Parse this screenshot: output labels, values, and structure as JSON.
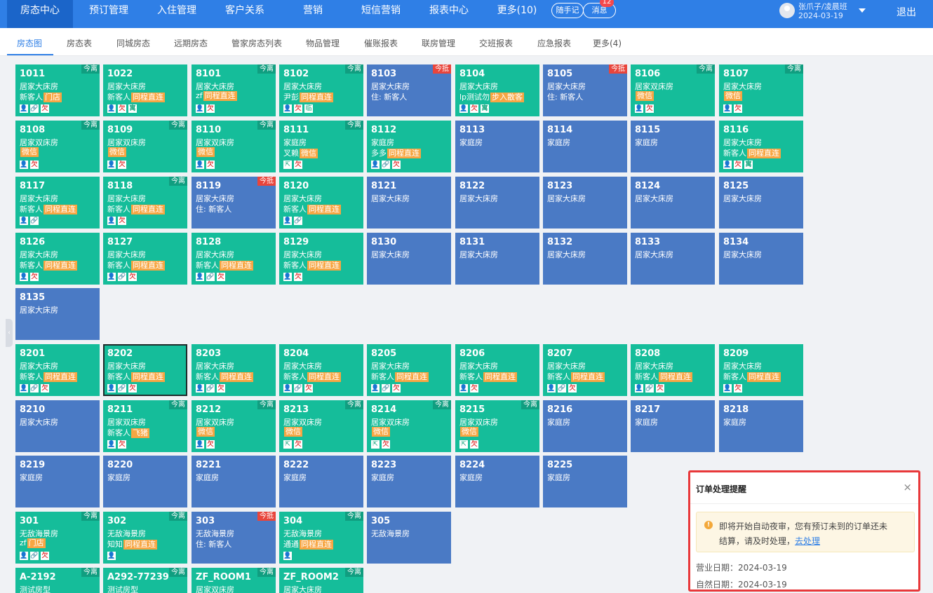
{
  "top_nav": {
    "items": [
      "房态中心",
      "预订管理",
      "入住管理",
      "客户关系",
      "营销",
      "短信营销",
      "报表中心",
      "更多(10)"
    ],
    "notes_label": "随手记",
    "messages_label": "消息",
    "messages_badge": "12",
    "user_name": "张爪子/凌晨班",
    "user_date": "2024-03-19",
    "logout_label": "退出"
  },
  "sub_nav": {
    "tabs": [
      "房态图",
      "房态表",
      "同城房态",
      "远期房态",
      "管家房态列表",
      "物品管理",
      "催账报表",
      "联房管理",
      "交班报表",
      "应急报表",
      "更多(4)"
    ]
  },
  "rooms": [
    {
      "no": "1011",
      "type": "居家大床房",
      "occ": true,
      "guest": "新客人",
      "tag": "门店",
      "icons": [
        "person",
        "link",
        "owe"
      ],
      "corner": "今离",
      "corner_type": "dep"
    },
    {
      "no": "1022",
      "type": "居家大床房",
      "occ": true,
      "guest": "新客人",
      "tag": "同程直连",
      "icons": [
        "person",
        "owe",
        "stay"
      ]
    },
    {
      "no": "8101",
      "type": "居家大床房",
      "occ": true,
      "guest": "zf",
      "tag": "同程直连",
      "icons": [
        "person",
        "owe"
      ],
      "corner": "今离",
      "corner_type": "dep"
    },
    {
      "no": "8102",
      "type": "居家大床房",
      "occ": true,
      "guest": "尹彭",
      "tag": "同程直连",
      "icons": [
        "person",
        "owe",
        "temp"
      ],
      "corner": "今离",
      "corner_type": "dep"
    },
    {
      "no": "8103",
      "type": "居家大床房",
      "occ": false,
      "line3": "住: 新客人",
      "corner": "今抵",
      "corner_type": "arr"
    },
    {
      "no": "8104",
      "type": "居家大床房",
      "occ": true,
      "guest": "lp测试勿",
      "tag": "步入散客",
      "icons": [
        "person",
        "owe",
        "stay"
      ]
    },
    {
      "no": "8105",
      "type": "居家大床房",
      "occ": false,
      "line3": "住: 新客人",
      "corner": "今抵",
      "corner_type": "arr"
    },
    {
      "no": "8106",
      "type": "居家双床房",
      "occ": true,
      "guest": "",
      "tag": "微信",
      "icons": [
        "person",
        "owe"
      ],
      "corner": "今离",
      "corner_type": "dep"
    },
    {
      "no": "8107",
      "type": "居家大床房",
      "occ": true,
      "guest": "",
      "tag": "微信",
      "icons": [
        "person",
        "owe"
      ],
      "corner": "今离",
      "corner_type": "dep"
    },
    {
      "no": "8108",
      "type": "居家双床房",
      "occ": true,
      "guest": "",
      "tag": "微信",
      "icons": [
        "person",
        "owe"
      ],
      "corner": "今离",
      "corner_type": "dep"
    },
    {
      "no": "8109",
      "type": "居家双床房",
      "occ": true,
      "guest": "",
      "tag": "微信",
      "icons": [
        "person",
        "owe"
      ],
      "corner": "今离",
      "corner_type": "dep"
    },
    {
      "no": "8110",
      "type": "居家双床房",
      "occ": true,
      "guest": "",
      "tag": "微信",
      "icons": [
        "person",
        "owe"
      ],
      "corner": "今离",
      "corner_type": "dep"
    },
    {
      "no": "8111",
      "type": "家庭房",
      "occ": true,
      "guest": "叉赖",
      "tag": "微信",
      "icons": [
        "arrow",
        "owe"
      ],
      "corner": "今离",
      "corner_type": "dep"
    },
    {
      "no": "8112",
      "type": "家庭房",
      "occ": true,
      "guest": "多多",
      "tag": "同程直连",
      "icons": [
        "person",
        "link",
        "owe"
      ]
    },
    {
      "no": "8113",
      "type": "家庭房",
      "occ": false
    },
    {
      "no": "8114",
      "type": "家庭房",
      "occ": false
    },
    {
      "no": "8115",
      "type": "家庭房",
      "occ": false
    },
    {
      "no": "8116",
      "type": "居家大床房",
      "occ": true,
      "guest": "新客人",
      "tag": "同程直连",
      "icons": [
        "person",
        "owe",
        "stay"
      ]
    },
    {
      "no": "8117",
      "type": "居家大床房",
      "occ": true,
      "guest": "新客人",
      "tag": "同程直连",
      "icons": [
        "person",
        "link"
      ]
    },
    {
      "no": "8118",
      "type": "居家大床房",
      "occ": true,
      "guest": "新客人",
      "tag": "同程直连",
      "icons": [
        "person",
        "owe"
      ],
      "corner": "今离",
      "corner_type": "dep"
    },
    {
      "no": "8119",
      "type": "居家大床房",
      "occ": false,
      "line3": "住: 新客人",
      "corner": "今抵",
      "corner_type": "arr"
    },
    {
      "no": "8120",
      "type": "居家大床房",
      "occ": true,
      "guest": "新客人",
      "tag": "同程直连",
      "icons": [
        "person",
        "link"
      ]
    },
    {
      "no": "8121",
      "type": "居家大床房",
      "occ": false
    },
    {
      "no": "8122",
      "type": "居家大床房",
      "occ": false
    },
    {
      "no": "8123",
      "type": "居家大床房",
      "occ": false
    },
    {
      "no": "8124",
      "type": "居家大床房",
      "occ": false
    },
    {
      "no": "8125",
      "type": "居家大床房",
      "occ": false
    },
    {
      "no": "8126",
      "type": "居家大床房",
      "occ": true,
      "guest": "新客人",
      "tag": "同程直连",
      "icons": [
        "person",
        "owe"
      ]
    },
    {
      "no": "8127",
      "type": "居家大床房",
      "occ": true,
      "guest": "新客人",
      "tag": "同程直连",
      "icons": [
        "person",
        "link",
        "owe"
      ]
    },
    {
      "no": "8128",
      "type": "居家大床房",
      "occ": true,
      "guest": "新客人",
      "tag": "同程直连",
      "icons": [
        "person",
        "link",
        "owe"
      ]
    },
    {
      "no": "8129",
      "type": "居家大床房",
      "occ": true,
      "guest": "新客人",
      "tag": "同程直连",
      "icons": [
        "person",
        "owe"
      ]
    },
    {
      "no": "8130",
      "type": "居家大床房",
      "occ": false
    },
    {
      "no": "8131",
      "type": "居家大床房",
      "occ": false
    },
    {
      "no": "8132",
      "type": "居家大床房",
      "occ": false
    },
    {
      "no": "8133",
      "type": "居家大床房",
      "occ": false
    },
    {
      "no": "8134",
      "type": "居家大床房",
      "occ": false
    },
    {
      "no": "8135",
      "type": "居家大床房",
      "occ": false
    },
    {
      "no": "8201",
      "type": "居家大床房",
      "occ": true,
      "guest": "新客人",
      "tag": "同程直连",
      "icons": [
        "person",
        "link",
        "owe"
      ]
    },
    {
      "no": "8202",
      "type": "居家大床房",
      "occ": true,
      "guest": "新客人",
      "tag": "同程直连",
      "icons": [
        "person",
        "link",
        "owe"
      ],
      "selected": true
    },
    {
      "no": "8203",
      "type": "居家大床房",
      "occ": true,
      "guest": "新客人",
      "tag": "同程直连",
      "icons": [
        "person",
        "link",
        "owe"
      ]
    },
    {
      "no": "8204",
      "type": "居家大床房",
      "occ": true,
      "guest": "新客人",
      "tag": "同程直连",
      "icons": [
        "person",
        "link",
        "owe"
      ]
    },
    {
      "no": "8205",
      "type": "居家大床房",
      "occ": true,
      "guest": "新客人",
      "tag": "同程直连",
      "icons": [
        "person",
        "link",
        "owe"
      ]
    },
    {
      "no": "8206",
      "type": "居家大床房",
      "occ": true,
      "guest": "新客人",
      "tag": "同程直连",
      "icons": [
        "person",
        "owe"
      ]
    },
    {
      "no": "8207",
      "type": "居家大床房",
      "occ": true,
      "guest": "新客人",
      "tag": "同程直连",
      "icons": [
        "person",
        "link",
        "owe"
      ]
    },
    {
      "no": "8208",
      "type": "居家大床房",
      "occ": true,
      "guest": "新客人",
      "tag": "同程直连",
      "icons": [
        "person",
        "link",
        "owe"
      ]
    },
    {
      "no": "8209",
      "type": "居家大床房",
      "occ": true,
      "guest": "新客人",
      "tag": "同程直连",
      "icons": [
        "person",
        "owe"
      ]
    },
    {
      "no": "8210",
      "type": "居家大床房",
      "occ": false
    },
    {
      "no": "8211",
      "type": "居家双床房",
      "occ": true,
      "guest": "新客人",
      "tag": "飞猪",
      "icons": [
        "person",
        "owe"
      ],
      "corner": "今离",
      "corner_type": "dep"
    },
    {
      "no": "8212",
      "type": "居家双床房",
      "occ": true,
      "guest": "",
      "tag": "微信",
      "icons": [
        "person",
        "owe"
      ],
      "corner": "今离",
      "corner_type": "dep"
    },
    {
      "no": "8213",
      "type": "居家双床房",
      "occ": true,
      "guest": "",
      "tag": "微信",
      "icons": [
        "arrow",
        "owe"
      ],
      "corner": "今离",
      "corner_type": "dep"
    },
    {
      "no": "8214",
      "type": "居家双床房",
      "occ": true,
      "guest": "",
      "tag": "微信",
      "icons": [
        "arrow",
        "owe"
      ],
      "corner": "今离",
      "corner_type": "dep"
    },
    {
      "no": "8215",
      "type": "居家双床房",
      "occ": true,
      "guest": "",
      "tag": "微信",
      "icons": [
        "arrow",
        "owe"
      ],
      "corner": "今离",
      "corner_type": "dep"
    },
    {
      "no": "8216",
      "type": "家庭房",
      "occ": false
    },
    {
      "no": "8217",
      "type": "家庭房",
      "occ": false
    },
    {
      "no": "8218",
      "type": "家庭房",
      "occ": false
    },
    {
      "no": "8219",
      "type": "家庭房",
      "occ": false
    },
    {
      "no": "8220",
      "type": "家庭房",
      "occ": false
    },
    {
      "no": "8221",
      "type": "家庭房",
      "occ": false
    },
    {
      "no": "8222",
      "type": "家庭房",
      "occ": false
    },
    {
      "no": "8223",
      "type": "家庭房",
      "occ": false
    },
    {
      "no": "8224",
      "type": "家庭房",
      "occ": false
    },
    {
      "no": "8225",
      "type": "家庭房",
      "occ": false
    },
    {
      "no": "301",
      "type": "无敌海景房",
      "occ": true,
      "guest": "zf",
      "tag": "门店",
      "icons": [
        "person",
        "link",
        "owe"
      ],
      "corner": "今离",
      "corner_type": "dep"
    },
    {
      "no": "302",
      "type": "无敌海景房",
      "occ": true,
      "guest": "知知",
      "tag": "同程直连",
      "icons": [
        "person"
      ],
      "corner": "今离",
      "corner_type": "dep"
    },
    {
      "no": "303",
      "type": "无敌海景房",
      "occ": false,
      "line3": "住: 新客人",
      "corner": "今抵",
      "corner_type": "arr"
    },
    {
      "no": "304",
      "type": "无敌海景房",
      "occ": true,
      "guest": "通通",
      "tag": "同程直连",
      "icons": [
        "person"
      ],
      "corner": "今离",
      "corner_type": "dep"
    },
    {
      "no": "305",
      "type": "无敌海景房",
      "occ": false
    },
    {
      "no": "A-2192",
      "type": "测试房型",
      "occ": true,
      "corner": "今离",
      "corner_type": "dep"
    },
    {
      "no": "A292-77239",
      "type": "测试房型",
      "occ": true,
      "corner": "今离",
      "corner_type": "dep"
    },
    {
      "no": "ZF_ROOM1",
      "type": "居家双床房",
      "occ": true,
      "corner": "今离",
      "corner_type": "dep"
    },
    {
      "no": "ZF_ROOM2",
      "type": "居家大床房",
      "occ": true,
      "corner": "今离",
      "corner_type": "dep"
    }
  ],
  "icon_glyphs": {
    "person": "👤",
    "link": "🔗",
    "owe": "欠",
    "stay": "寓",
    "temp": "临",
    "arrow": "⇱"
  },
  "colors": {
    "occupied": "#15bd9a",
    "vacant": "#4a7ac5",
    "tag": "#f7a643",
    "arrive": "#e8453c",
    "depart": "#109e80",
    "nav": "#2f7fe6"
  },
  "popup": {
    "title": "订单处理提醒",
    "close": "×",
    "warn_icon": "!",
    "message_line1": "即将开始自动夜审，您有预订未到的订单还未",
    "message_line2": "结算，请及时处理，",
    "link_label": "去处理",
    "business_date": "营业日期：2024-03-19",
    "natural_date": "自然日期：2024-03-19"
  }
}
